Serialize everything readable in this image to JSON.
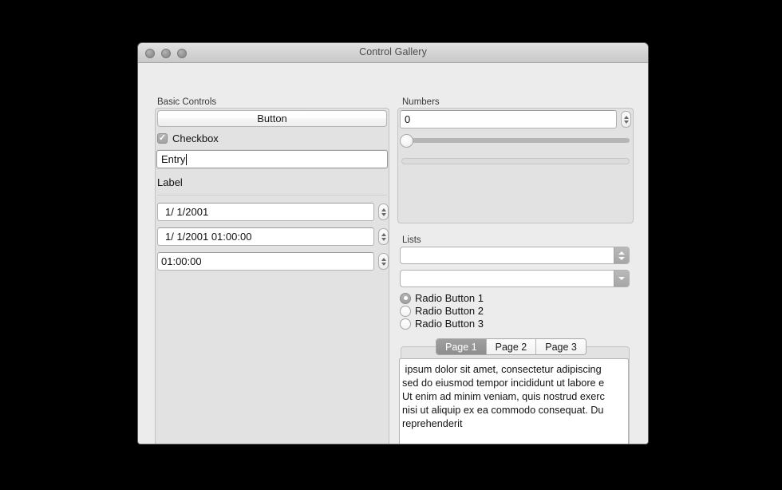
{
  "window": {
    "title": "Control Gallery",
    "traffic_lights": [
      "close-button",
      "minimize-button",
      "zoom-button"
    ]
  },
  "basic_controls": {
    "group_label": "Basic Controls",
    "button_label": "Button",
    "checkbox": {
      "label": "Checkbox",
      "checked": true,
      "glyph": "✓"
    },
    "entry": {
      "value": "Entry",
      "placeholder": ""
    },
    "label_text": "Label",
    "date_field": {
      "value": "1/  1/2001"
    },
    "datetime_field": {
      "value": "1/  1/2001 01:00:00"
    },
    "time_field": {
      "value": "01:00:00"
    }
  },
  "numbers": {
    "group_label": "Numbers",
    "spinbox": {
      "value": "0"
    },
    "slider": {
      "value": 0,
      "min": 0,
      "max": 100
    },
    "progress": {
      "value": 0,
      "min": 0,
      "max": 100
    }
  },
  "lists": {
    "group_label": "Lists",
    "popup_button": {
      "value": ""
    },
    "combo_box": {
      "value": "",
      "placeholder": ""
    },
    "radios": [
      {
        "label": "Radio Button 1",
        "selected": true
      },
      {
        "label": "Radio Button 2",
        "selected": false
      },
      {
        "label": "Radio Button 3",
        "selected": false
      }
    ]
  },
  "tabs": {
    "items": [
      {
        "label": "Page 1",
        "active": true
      },
      {
        "label": "Page 2",
        "active": false
      },
      {
        "label": "Page 3",
        "active": false
      }
    ],
    "text_lines": [
      " ipsum dolor sit amet, consectetur adipiscing",
      "sed do eiusmod tempor incididunt ut labore e",
      "Ut enim ad minim veniam, quis nostrud exerc",
      "nisi ut aliquip ex ea commodo consequat. Du",
      "reprehenderit"
    ]
  },
  "colors": {
    "window_background": "#ececec",
    "group_background": "#e2e2e2",
    "accent_selected": "#9f9f9f",
    "desktop": "#000000"
  }
}
